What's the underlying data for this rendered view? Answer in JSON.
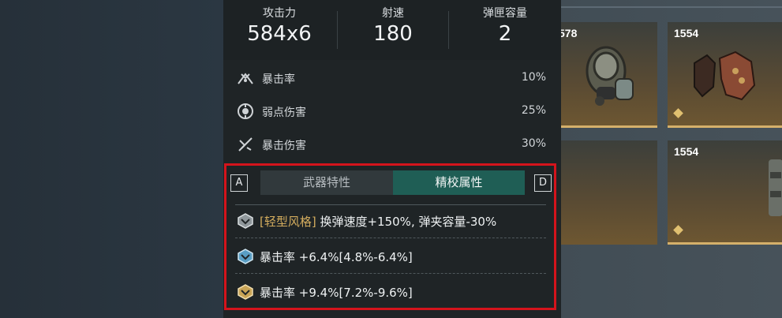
{
  "inventory": {
    "cards": [
      {
        "number": "578",
        "has_diamond": false
      },
      {
        "number": "1554",
        "has_diamond": true
      },
      {
        "number": "",
        "has_diamond": false
      },
      {
        "number": "1554",
        "has_diamond": true
      }
    ]
  },
  "stats": [
    {
      "label": "攻击力",
      "value": "584x6"
    },
    {
      "label": "射速",
      "value": "180"
    },
    {
      "label": "弹匣容量",
      "value": "2"
    }
  ],
  "sub_stats": [
    {
      "icon": "crit-rate-icon",
      "label": "暴击率",
      "value": "10%"
    },
    {
      "icon": "weakspot-icon",
      "label": "弱点伤害",
      "value": "25%"
    },
    {
      "icon": "crit-damage-icon",
      "label": "暴击伤害",
      "value": "30%"
    }
  ],
  "tabs": {
    "left_key": "A",
    "right_key": "D",
    "items": [
      {
        "label": "武器特性",
        "active": false
      },
      {
        "label": "精校属性",
        "active": true
      }
    ]
  },
  "properties": [
    {
      "icon": "calibration-icon-silver",
      "tag": "[轻型风格]",
      "text": " 换弹速度+150%, 弹夹容量-30%"
    },
    {
      "icon": "calibration-icon-blue",
      "tag": "",
      "text": "暴击率 +6.4%[4.8%-6.4%]"
    },
    {
      "icon": "calibration-icon-gold",
      "tag": "",
      "text": "暴击率 +9.4%[7.2%-9.6%]"
    }
  ],
  "colors": {
    "accent_tab": "#1f5e55",
    "highlight_frame": "#d4141c",
    "tag_gold": "#d4ad5e",
    "card_bottom": "#d5b06a"
  }
}
